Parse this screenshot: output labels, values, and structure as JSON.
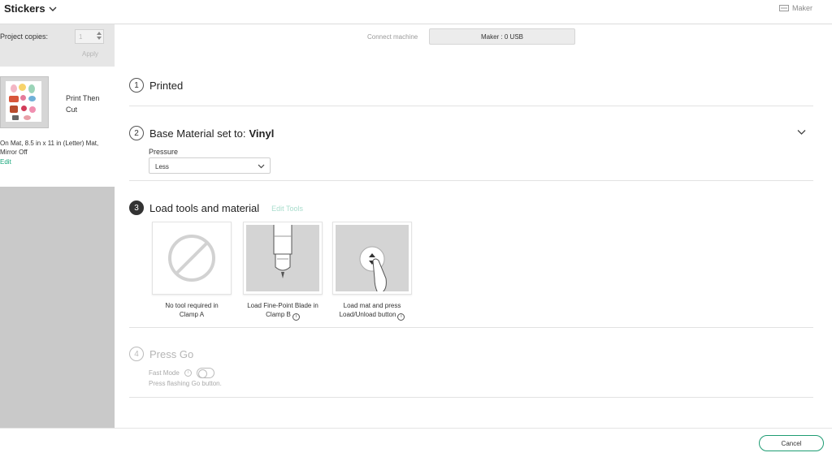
{
  "header": {
    "project_title": "Stickers",
    "machine_label": "Maker"
  },
  "sidebar": {
    "copies_label": "Project copies:",
    "copies_value": "1",
    "apply_label": "Apply",
    "mat": {
      "name": "Print Then Cut",
      "description": "On Mat, 8.5 in x 11 in (Letter) Mat, Mirror Off",
      "edit_label": "Edit"
    }
  },
  "connection": {
    "connect_label": "Connect machine",
    "machine_button": "Maker : 0 USB"
  },
  "steps": [
    {
      "number": "1",
      "title": "Printed"
    },
    {
      "number": "2",
      "title": "Base Material set to:",
      "value": "Vinyl"
    },
    {
      "number": "3",
      "title": "Load tools and material",
      "action": "Edit Tools"
    },
    {
      "number": "4",
      "title": "Press Go"
    }
  ],
  "material": {
    "pressure_label": "Pressure",
    "pressure_value": "Less"
  },
  "tools": [
    {
      "caption_line1": "No tool required in",
      "caption_line2": "Clamp A",
      "icon": "no-tool-icon"
    },
    {
      "caption_line1": "Load Fine-Point Blade in",
      "caption_line2": "Clamp B",
      "icon": "fine-point-blade-icon"
    },
    {
      "caption_line1": "Load mat and press",
      "caption_line2": "Load/Unload button",
      "icon": "load-unload-button-icon"
    }
  ],
  "press_go": {
    "fast_mode_label": "Fast Mode",
    "hint": "Press flashing Go button."
  },
  "footer": {
    "cancel_label": "Cancel"
  },
  "colors": {
    "accent": "#17a67a",
    "sidebar_bg": "#c9c9c9",
    "active_step": "#333333"
  }
}
